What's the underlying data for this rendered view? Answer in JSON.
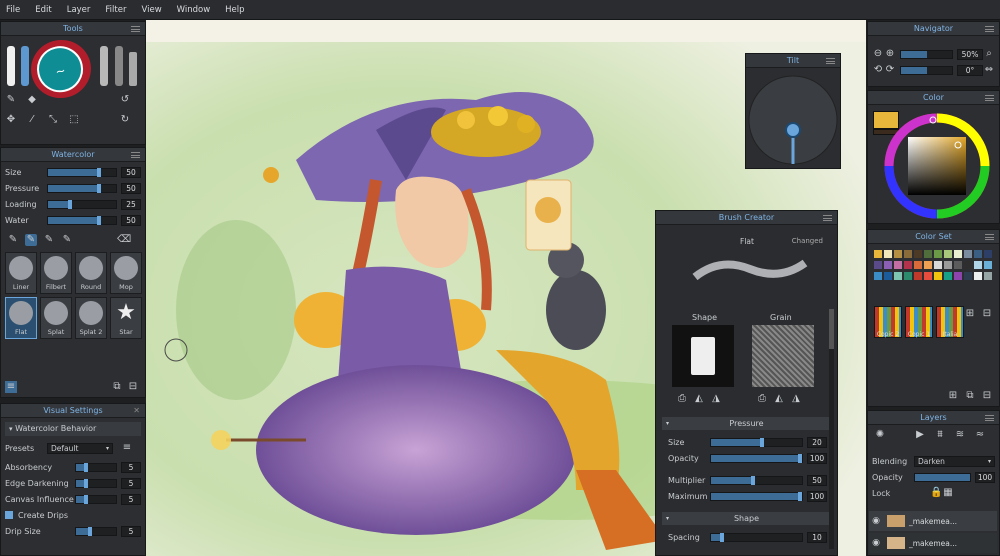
{
  "menu": [
    "File",
    "Edit",
    "Layer",
    "Filter",
    "View",
    "Window",
    "Help"
  ],
  "tools": {
    "title": "Tools"
  },
  "watercolor": {
    "title": "Watercolor",
    "sliders": [
      {
        "label": "Size",
        "value": "50",
        "frac": 0.78
      },
      {
        "label": "Pressure",
        "value": "50",
        "frac": 0.78
      },
      {
        "label": "Loading",
        "value": "25",
        "frac": 0.36
      },
      {
        "label": "Water",
        "value": "50",
        "frac": 0.78
      }
    ],
    "brushes": [
      "Liner",
      "Filbert",
      "Round",
      "Mop",
      "Flat",
      "Splat",
      "Splat 2",
      "Star"
    ]
  },
  "visual": {
    "title": "Visual Settings",
    "section": "Watercolor Behavior",
    "presets_label": "Presets",
    "presets_value": "Default",
    "rows": [
      {
        "label": "Absorbency",
        "value": "5",
        "frac": 0.3
      },
      {
        "label": "Edge Darkening",
        "value": "5",
        "frac": 0.3
      },
      {
        "label": "Canvas Influence",
        "value": "5",
        "frac": 0.3
      }
    ],
    "checkbox": "Create Drips",
    "drip": {
      "label": "Drip Size",
      "value": "5"
    }
  },
  "tilt": {
    "title": "Tilt"
  },
  "brush_creator": {
    "title": "Brush Creator",
    "name": "Flat",
    "state": "Changed",
    "shape_label": "Shape",
    "grain_label": "Grain",
    "pressure_header": "Pressure",
    "pressure_rows": [
      {
        "label": "Size",
        "value": "20",
        "frac": 0.58
      },
      {
        "label": "Opacity",
        "value": "100",
        "frac": 1.0
      }
    ],
    "mult_rows": [
      {
        "label": "Multiplier",
        "value": "50",
        "frac": 0.48
      },
      {
        "label": "Maximum",
        "value": "100",
        "frac": 1.0
      }
    ],
    "shape_header": "Shape",
    "spacing": {
      "label": "Spacing",
      "value": "10",
      "frac": 0.1
    }
  },
  "navigator": {
    "title": "Navigator",
    "zoom": "50%",
    "rotation": "0°"
  },
  "color": {
    "title": "Color",
    "current": "#e7b63a"
  },
  "color_set": {
    "title": "Color Set",
    "swatches": [
      "#e7b63a",
      "#f2e7b8",
      "#b58f42",
      "#8a6b3a",
      "#4d3a26",
      "#4f6e3c",
      "#6a9a45",
      "#a8c77a",
      "#e9efd0",
      "#7a8c9d",
      "#3b5f82",
      "#2d3f66",
      "#5a4a8a",
      "#8b5fb3",
      "#c36fa4",
      "#b4334c",
      "#d96b3b",
      "#f0a053",
      "#d9d9d9",
      "#9a9a9a",
      "#5c5c5c",
      "#2e2e2e",
      "#b0d4e8",
      "#6bb0d8",
      "#3a8dc7",
      "#1d5c9a",
      "#7fc6b2",
      "#2b8a6b",
      "#c0392b",
      "#e74c3c",
      "#f1c40f",
      "#16a085",
      "#8e44ad",
      "#2c3e50",
      "#ecf0f1",
      "#95a5a6"
    ],
    "thumbs": [
      "Copic 2",
      "Copic 1",
      "Italia"
    ]
  },
  "layers": {
    "title": "Layers",
    "blending_label": "Blending",
    "blending_value": "Darken",
    "opacity_label": "Opacity",
    "opacity_value": "100",
    "lock_label": "Lock",
    "items": [
      "_makemea...",
      "_makemea..."
    ]
  }
}
